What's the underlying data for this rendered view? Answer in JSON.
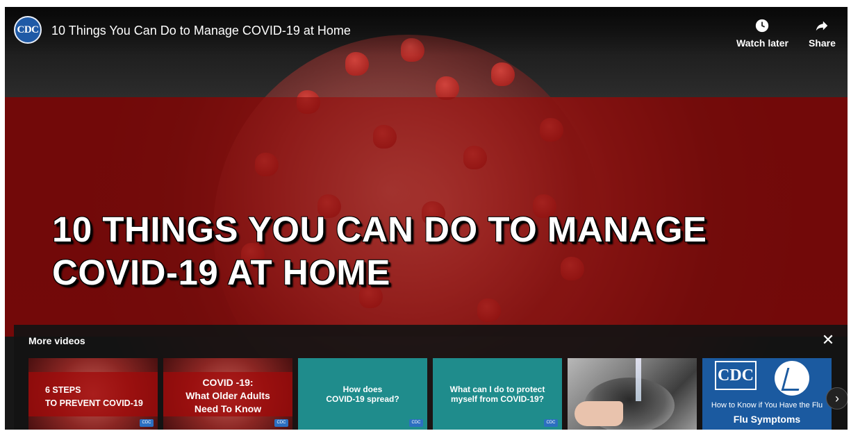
{
  "header": {
    "logo_text": "CDC",
    "title": "10 Things You Can Do to Manage COVID-19 at Home",
    "watch_later_label": "Watch later",
    "share_label": "Share"
  },
  "video": {
    "headline_line1": "10 THINGS YOU CAN DO TO MANAGE",
    "headline_line2": "COVID-19 AT HOME"
  },
  "more_videos": {
    "title": "More videos",
    "close_glyph": "✕",
    "next_glyph": "›",
    "items": [
      {
        "line1": "6 STEPS",
        "line2": "TO PREVENT COVID-19"
      },
      {
        "line1": "COVID -19:",
        "line2": "What Older Adults",
        "line3": "Need To Know"
      },
      {
        "line1": "How does",
        "line2": "COVID-19 spread?"
      },
      {
        "line1": "What can I do to protect",
        "line2": "myself from COVID-19?"
      },
      {},
      {
        "logo": "CDC",
        "line1": "How to Know if You Have the Flu",
        "line2": "Flu Symptoms"
      }
    ]
  }
}
